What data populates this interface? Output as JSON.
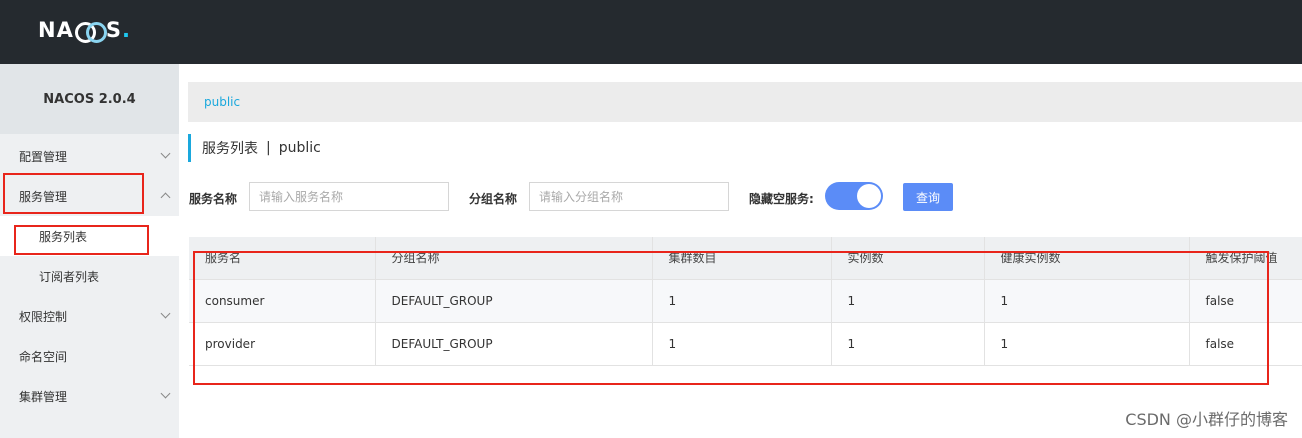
{
  "app": {
    "logo_text_left": "NA",
    "logo_text_right": "S",
    "logo_dot": ".",
    "version": "NACOS 2.0.4"
  },
  "sidebar": {
    "items": [
      {
        "label": "配置管理"
      },
      {
        "label": "服务管理"
      },
      {
        "label": "服务列表"
      },
      {
        "label": "订阅者列表"
      },
      {
        "label": "权限控制"
      },
      {
        "label": "命名空间"
      },
      {
        "label": "集群管理"
      }
    ]
  },
  "namespace_bar": {
    "current": "public"
  },
  "page": {
    "title": "服务列表",
    "separator": "|",
    "namespace": "public"
  },
  "filters": {
    "service_name_label": "服务名称",
    "service_name_placeholder": "请输入服务名称",
    "group_name_label": "分组名称",
    "group_name_placeholder": "请输入分组名称",
    "hide_empty_label": "隐藏空服务:",
    "hide_empty_on": true,
    "query_label": "查询"
  },
  "table": {
    "headers": [
      "服务名",
      "分组名称",
      "集群数目",
      "实例数",
      "健康实例数",
      "触发保护阈值"
    ],
    "rows": [
      [
        "consumer",
        "DEFAULT_GROUP",
        "1",
        "1",
        "1",
        "false"
      ],
      [
        "provider",
        "DEFAULT_GROUP",
        "1",
        "1",
        "1",
        "false"
      ]
    ]
  },
  "watermark": "CSDN @小群仔的博客",
  "colors": {
    "topbar": "#252a2f",
    "accent": "#1aa8dd",
    "primary_button": "#5b8cf7",
    "highlight": "#e8251b"
  }
}
